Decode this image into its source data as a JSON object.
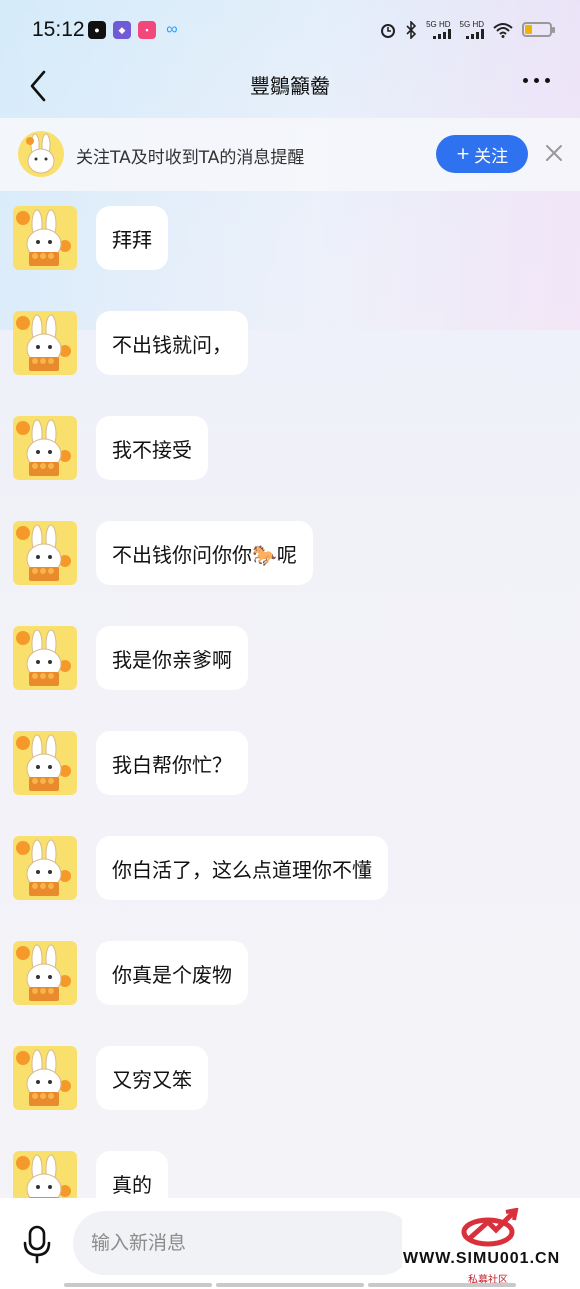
{
  "status_bar": {
    "time": "15:12",
    "app_icons": [
      "wechat-icon",
      "notes-icon",
      "bilibili-icon",
      "cloud-icon"
    ],
    "network_left": "5G HD",
    "network_right": "5G HD",
    "battery_level": 0.3
  },
  "nav": {
    "title": "豐鶵籲齤"
  },
  "follow_banner": {
    "text": "关注TA及时收到TA的消息提醒",
    "button_label": "关注",
    "button_icon": "+",
    "close_icon": "×"
  },
  "messages": [
    {
      "text": "拜拜"
    },
    {
      "text": "不出钱就问，"
    },
    {
      "text": "我不接受"
    },
    {
      "text": "不出钱你问你你🐎呢"
    },
    {
      "text": "我是你亲爹啊"
    },
    {
      "text": "我白帮你忙？"
    },
    {
      "text": "你白活了，这么点道理你不懂"
    },
    {
      "text": "你真是个废物"
    },
    {
      "text": "又穷又笨"
    },
    {
      "text": "真的"
    }
  ],
  "input": {
    "placeholder": "输入新消息"
  },
  "watermark": {
    "url": "WWW.SIMU001.CN",
    "subtitle": "私募社区"
  },
  "colors": {
    "accent": "#2f72f0",
    "bubble": "#ffffff",
    "avatar_bg": "#f9e06c"
  }
}
